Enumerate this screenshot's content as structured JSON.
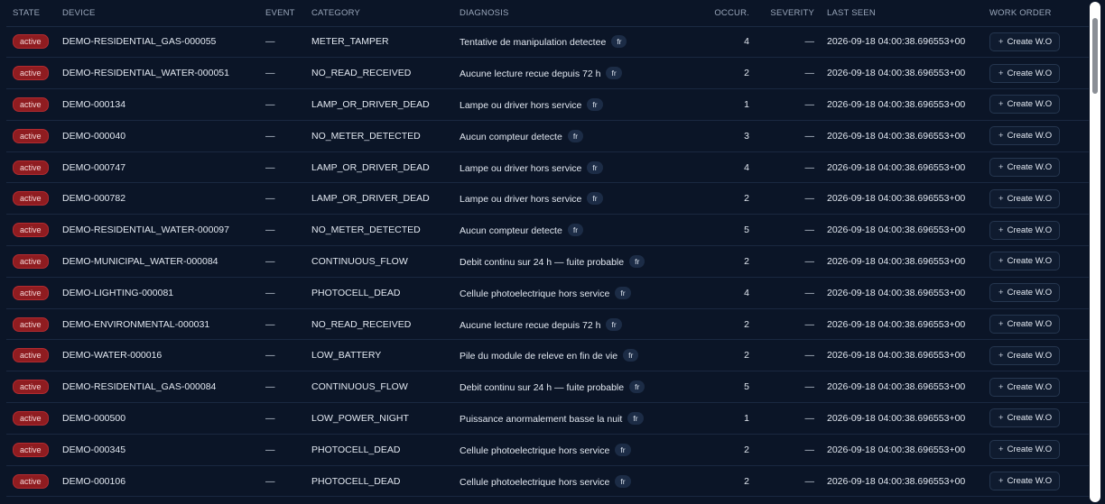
{
  "columns": {
    "state": "STATE",
    "device": "DEVICE",
    "event": "EVENT",
    "category": "CATEGORY",
    "diagnosis": "DIAGNOSIS",
    "occurrences": "OCCUR.",
    "severity": "SEVERITY",
    "last_seen": "LAST SEEN",
    "work_order": "WORK ORDER"
  },
  "state_badge_color": "#8f1c20",
  "rows": [
    {
      "state": "active",
      "device": "DEMO-RESIDENTIAL_GAS-000055",
      "event": "—",
      "category": "METER_TAMPER",
      "diagnosis": "Tentative de manipulation detectee",
      "lang": "fr",
      "occurrences": "4",
      "severity": "—",
      "last_seen": "2026-09-18 04:00:38.696553+00",
      "action": "Create W.O"
    },
    {
      "state": "active",
      "device": "DEMO-RESIDENTIAL_WATER-000051",
      "event": "—",
      "category": "NO_READ_RECEIVED",
      "diagnosis": "Aucune lecture recue depuis 72 h",
      "lang": "fr",
      "occurrences": "2",
      "severity": "—",
      "last_seen": "2026-09-18 04:00:38.696553+00",
      "action": "Create W.O"
    },
    {
      "state": "active",
      "device": "DEMO-000134",
      "event": "—",
      "category": "LAMP_OR_DRIVER_DEAD",
      "diagnosis": "Lampe ou driver hors service",
      "lang": "fr",
      "occurrences": "1",
      "severity": "—",
      "last_seen": "2026-09-18 04:00:38.696553+00",
      "action": "Create W.O"
    },
    {
      "state": "active",
      "device": "DEMO-000040",
      "event": "—",
      "category": "NO_METER_DETECTED",
      "diagnosis": "Aucun compteur detecte",
      "lang": "fr",
      "occurrences": "3",
      "severity": "—",
      "last_seen": "2026-09-18 04:00:38.696553+00",
      "action": "Create W.O"
    },
    {
      "state": "active",
      "device": "DEMO-000747",
      "event": "—",
      "category": "LAMP_OR_DRIVER_DEAD",
      "diagnosis": "Lampe ou driver hors service",
      "lang": "fr",
      "occurrences": "4",
      "severity": "—",
      "last_seen": "2026-09-18 04:00:38.696553+00",
      "action": "Create W.O"
    },
    {
      "state": "active",
      "device": "DEMO-000782",
      "event": "—",
      "category": "LAMP_OR_DRIVER_DEAD",
      "diagnosis": "Lampe ou driver hors service",
      "lang": "fr",
      "occurrences": "2",
      "severity": "—",
      "last_seen": "2026-09-18 04:00:38.696553+00",
      "action": "Create W.O"
    },
    {
      "state": "active",
      "device": "DEMO-RESIDENTIAL_WATER-000097",
      "event": "—",
      "category": "NO_METER_DETECTED",
      "diagnosis": "Aucun compteur detecte",
      "lang": "fr",
      "occurrences": "5",
      "severity": "—",
      "last_seen": "2026-09-18 04:00:38.696553+00",
      "action": "Create W.O"
    },
    {
      "state": "active",
      "device": "DEMO-MUNICIPAL_WATER-000084",
      "event": "—",
      "category": "CONTINUOUS_FLOW",
      "diagnosis": "Debit continu sur 24 h — fuite probable",
      "lang": "fr",
      "occurrences": "2",
      "severity": "—",
      "last_seen": "2026-09-18 04:00:38.696553+00",
      "action": "Create W.O"
    },
    {
      "state": "active",
      "device": "DEMO-LIGHTING-000081",
      "event": "—",
      "category": "PHOTOCELL_DEAD",
      "diagnosis": "Cellule photoelectrique hors service",
      "lang": "fr",
      "occurrences": "4",
      "severity": "—",
      "last_seen": "2026-09-18 04:00:38.696553+00",
      "action": "Create W.O"
    },
    {
      "state": "active",
      "device": "DEMO-ENVIRONMENTAL-000031",
      "event": "—",
      "category": "NO_READ_RECEIVED",
      "diagnosis": "Aucune lecture recue depuis 72 h",
      "lang": "fr",
      "occurrences": "2",
      "severity": "—",
      "last_seen": "2026-09-18 04:00:38.696553+00",
      "action": "Create W.O"
    },
    {
      "state": "active",
      "device": "DEMO-WATER-000016",
      "event": "—",
      "category": "LOW_BATTERY",
      "diagnosis": "Pile du module de releve en fin de vie",
      "lang": "fr",
      "occurrences": "2",
      "severity": "—",
      "last_seen": "2026-09-18 04:00:38.696553+00",
      "action": "Create W.O"
    },
    {
      "state": "active",
      "device": "DEMO-RESIDENTIAL_GAS-000084",
      "event": "—",
      "category": "CONTINUOUS_FLOW",
      "diagnosis": "Debit continu sur 24 h — fuite probable",
      "lang": "fr",
      "occurrences": "5",
      "severity": "—",
      "last_seen": "2026-09-18 04:00:38.696553+00",
      "action": "Create W.O"
    },
    {
      "state": "active",
      "device": "DEMO-000500",
      "event": "—",
      "category": "LOW_POWER_NIGHT",
      "diagnosis": "Puissance anormalement basse la nuit",
      "lang": "fr",
      "occurrences": "1",
      "severity": "—",
      "last_seen": "2026-09-18 04:00:38.696553+00",
      "action": "Create W.O"
    },
    {
      "state": "active",
      "device": "DEMO-000345",
      "event": "—",
      "category": "PHOTOCELL_DEAD",
      "diagnosis": "Cellule photoelectrique hors service",
      "lang": "fr",
      "occurrences": "2",
      "severity": "—",
      "last_seen": "2026-09-18 04:00:38.696553+00",
      "action": "Create W.O"
    },
    {
      "state": "active",
      "device": "DEMO-000106",
      "event": "—",
      "category": "PHOTOCELL_DEAD",
      "diagnosis": "Cellule photoelectrique hors service",
      "lang": "fr",
      "occurrences": "2",
      "severity": "—",
      "last_seen": "2026-09-18 04:00:38.696553+00",
      "action": "Create W.O"
    }
  ]
}
